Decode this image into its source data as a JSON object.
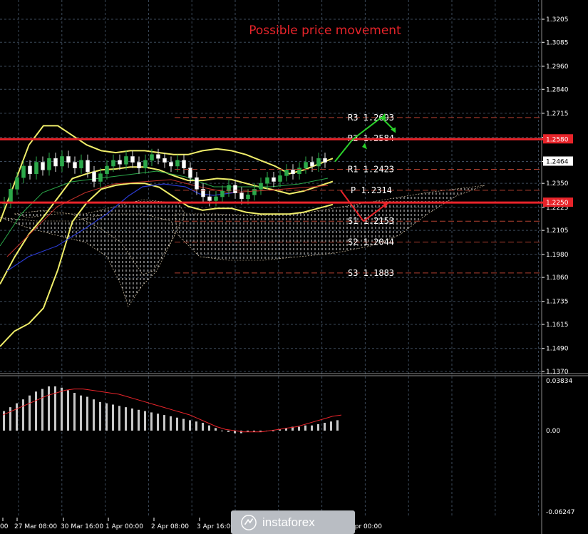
{
  "title": "Possible price movement",
  "watermark": "instaforex",
  "colors": {
    "background": "#000000",
    "grid": "#3c4a5a",
    "level_line": "#e8242a",
    "bollinger": "#f0ee6a",
    "candle_up": "#2ba84a",
    "candle_down": "#ffffff",
    "arrow_up": "#2bd12b",
    "arrow_down": "#e8242a",
    "macd_hist": "#c8c8c8",
    "macd_signal": "#e8242a"
  },
  "price_axis_labels": [
    "1.3205",
    "1.3085",
    "1.2960",
    "1.2840",
    "1.2715",
    "1.2590",
    "1.2464",
    "1.2350",
    "1.2225",
    "1.2105",
    "1.1980",
    "1.1860",
    "1.1735",
    "1.1615",
    "1.1490",
    "1.1370"
  ],
  "macd_axis_labels": [
    "0.03834",
    "0.00",
    "-0.06247"
  ],
  "time_labels": [
    "00",
    "27 Mar 08:00",
    "30 Mar 16:00",
    "1 Apr 00:00",
    "2 Apr 08:00",
    "3 Apr 16:00",
    "7 Apr 00:00"
  ],
  "price_tags": [
    {
      "text": "1.2580",
      "value": 1.258,
      "color": "#e8242a",
      "text_color": "#ffffff"
    },
    {
      "text": "1.2464",
      "value": 1.2464,
      "color": "#ffffff",
      "text_color": "#000000"
    },
    {
      "text": "1.2250",
      "value": 1.225,
      "color": "#e8242a",
      "text_color": "#ffffff"
    }
  ],
  "pivot_levels": [
    {
      "label": "R3 1.2693",
      "value": 1.2693
    },
    {
      "label": "R2 1.2584",
      "value": 1.2584
    },
    {
      "label": "R1 1.2423",
      "value": 1.2423
    },
    {
      "label": "P 1.2314",
      "value": 1.2314
    },
    {
      "label": "S1 1.2153",
      "value": 1.2153
    },
    {
      "label": "S2 1.2044",
      "value": 1.2044
    },
    {
      "label": "S3 1.1883",
      "value": 1.1883
    }
  ],
  "chart_data": {
    "type": "candlestick",
    "title": "Possible price movement",
    "ylim": [
      1.137,
      1.3205
    ],
    "macd_ylim": [
      -0.06247,
      0.03834
    ],
    "horizontal_levels": [
      1.258,
      1.225
    ],
    "candles_close": [
      1.225,
      1.232,
      1.238,
      1.244,
      1.24,
      1.246,
      1.242,
      1.248,
      1.244,
      1.249,
      1.246,
      1.243,
      1.247,
      1.241,
      1.236,
      1.24,
      1.244,
      1.247,
      1.245,
      1.249,
      1.246,
      1.243,
      1.247,
      1.25,
      1.248,
      1.246,
      1.244,
      1.247,
      1.243,
      1.238,
      1.232,
      1.228,
      1.226,
      1.228,
      1.231,
      1.234,
      1.23,
      1.227,
      1.229,
      1.232,
      1.235,
      1.238,
      1.236,
      1.239,
      1.242,
      1.24,
      1.243,
      1.246,
      1.244,
      1.248,
      1.246
    ],
    "bollinger_upper": [
      1.215,
      1.235,
      1.255,
      1.265,
      1.265,
      1.26,
      1.255,
      1.252,
      1.251,
      1.252,
      1.252,
      1.251,
      1.25,
      1.25,
      1.252,
      1.253,
      1.252,
      1.25,
      1.247,
      1.244,
      1.24,
      1.242,
      1.245,
      1.248
    ],
    "bollinger_lower": [
      1.15,
      1.158,
      1.162,
      1.17,
      1.19,
      1.215,
      1.225,
      1.232,
      1.234,
      1.235,
      1.235,
      1.233,
      1.228,
      1.223,
      1.221,
      1.222,
      1.222,
      1.22,
      1.219,
      1.219,
      1.219,
      1.22,
      1.222,
      1.224
    ],
    "forecast_up": [
      [
        1.2464,
        1.258
      ],
      [
        1.258,
        1.2693
      ],
      [
        1.2693,
        1.262
      ]
    ],
    "forecast_down": [
      [
        1.2314,
        1.2153
      ],
      [
        1.2153,
        1.225
      ]
    ],
    "macd_histogram": [
      0.015,
      0.018,
      0.021,
      0.024,
      0.027,
      0.03,
      0.032,
      0.034,
      0.034,
      0.033,
      0.031,
      0.029,
      0.027,
      0.026,
      0.024,
      0.022,
      0.021,
      0.02,
      0.019,
      0.018,
      0.017,
      0.016,
      0.015,
      0.014,
      0.013,
      0.012,
      0.011,
      0.01,
      0.009,
      0.008,
      0.007,
      0.006,
      0.004,
      0.002,
      0.0,
      -0.001,
      -0.002,
      -0.002,
      -0.001,
      -0.001,
      -0.001,
      0.0,
      0.0,
      0.001,
      0.002,
      0.003,
      0.003,
      0.004,
      0.004,
      0.005,
      0.006,
      0.007,
      0.008
    ],
    "macd_signal": [
      0.012,
      0.015,
      0.018,
      0.021,
      0.024,
      0.027,
      0.029,
      0.031,
      0.032,
      0.032,
      0.031,
      0.03,
      0.029,
      0.028,
      0.026,
      0.024,
      0.022,
      0.02,
      0.018,
      0.016,
      0.014,
      0.012,
      0.009,
      0.006,
      0.003,
      0.001,
      0.0,
      -0.001,
      -0.001,
      -0.001,
      0.0,
      0.001,
      0.002,
      0.003,
      0.005,
      0.007,
      0.009,
      0.011,
      0.012
    ]
  }
}
